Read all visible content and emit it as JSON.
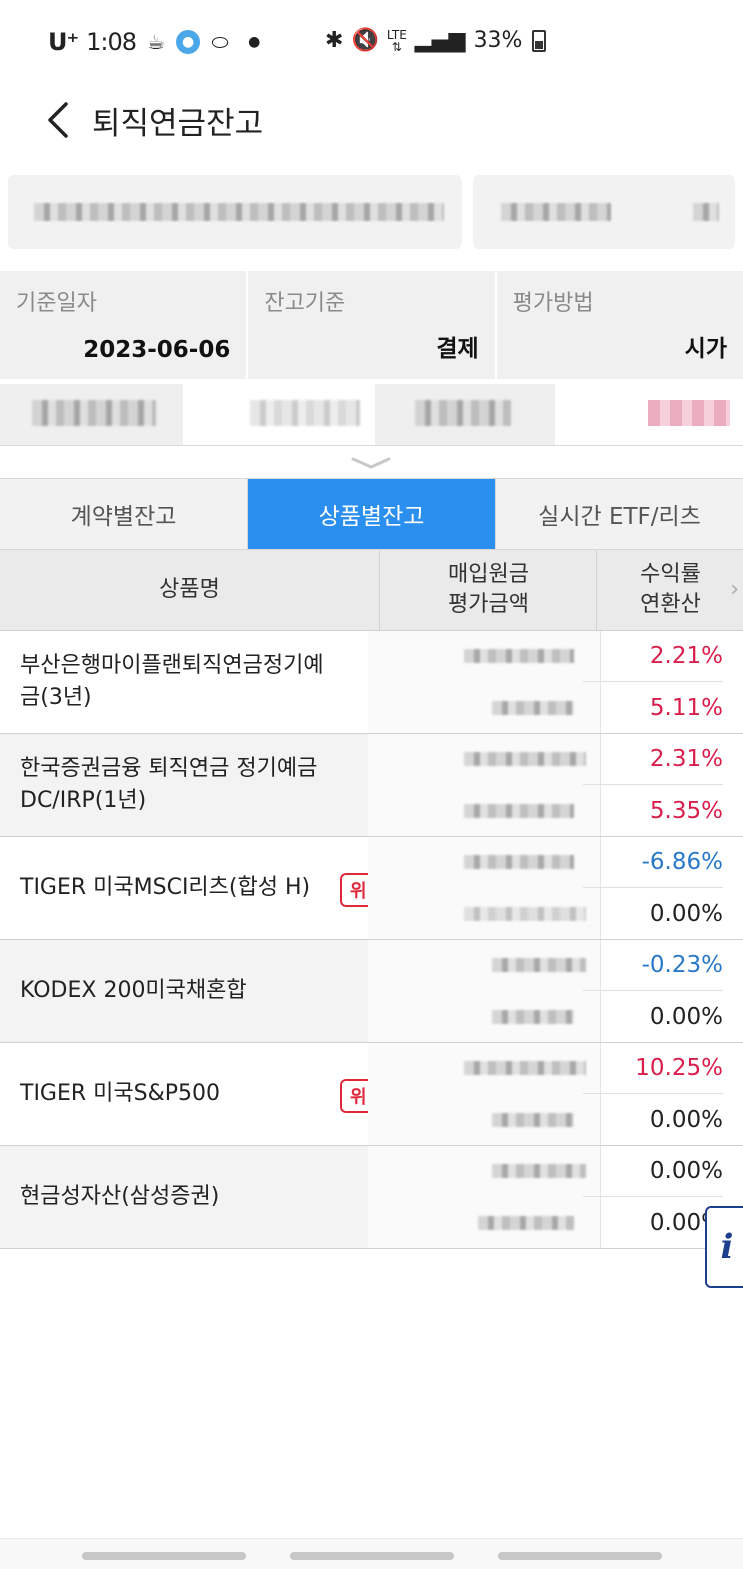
{
  "status_bar": {
    "carrier": "U⁺",
    "time": "1:08",
    "battery": "33%",
    "network": "LTE",
    "icons": [
      "coffee-icon",
      "location-icon",
      "pill-icon",
      "dot-icon",
      "bluetooth-icon",
      "mute-icon",
      "lte-icon",
      "signal-icon",
      "battery-icon"
    ]
  },
  "header": {
    "title": "퇴직연금잔고",
    "back_icon": "chevron-left-icon"
  },
  "info": {
    "cells": [
      {
        "label": "기준일자",
        "value": "2023-06-06"
      },
      {
        "label": "잔고기준",
        "value": "결제"
      },
      {
        "label": "평가방법",
        "value": "시가"
      }
    ]
  },
  "tabs": [
    {
      "label": "계약별잔고",
      "active": false
    },
    {
      "label": "상품별잔고",
      "active": true
    },
    {
      "label": "실시간 ETF/리츠",
      "active": false
    }
  ],
  "table": {
    "headers": {
      "product": "상품명",
      "principal_line1": "매입원금",
      "principal_line2": "평가금액",
      "rate_line1": "수익률",
      "rate_line2": "연환산"
    },
    "rows": [
      {
        "name": "부산은행마이플랜퇴직연금정기예금(3년)",
        "badge": "",
        "rate": "2.21%",
        "annualized": "5.11%",
        "rate_sign": "pos",
        "ann_sign": "pos",
        "shaded": false
      },
      {
        "name": "한국증권금융 퇴직연금 정기예금 DC/IRP(1년)",
        "badge": "",
        "rate": "2.31%",
        "annualized": "5.35%",
        "rate_sign": "pos",
        "ann_sign": "pos",
        "shaded": true
      },
      {
        "name": "TIGER 미국MSCI리츠(합성 H)",
        "badge": "위",
        "rate": "-6.86%",
        "annualized": "0.00%",
        "rate_sign": "neg",
        "ann_sign": "zero",
        "shaded": false
      },
      {
        "name": "KODEX 200미국채혼합",
        "badge": "",
        "rate": "-0.23%",
        "annualized": "0.00%",
        "rate_sign": "neg",
        "ann_sign": "zero",
        "shaded": true
      },
      {
        "name": "TIGER 미국S&P500",
        "badge": "위",
        "rate": "10.25%",
        "annualized": "0.00%",
        "rate_sign": "pos",
        "ann_sign": "zero",
        "shaded": false
      },
      {
        "name": "현금성자산(삼성증권)",
        "badge": "",
        "rate": "0.00%",
        "annualized": "0.00%",
        "rate_sign": "zero",
        "ann_sign": "zero",
        "shaded": true
      }
    ]
  },
  "fab": {
    "label": "i"
  },
  "colors": {
    "accent": "#2b8ff0",
    "positive": "#d81e4a",
    "negative": "#2a78c8",
    "badge": "#e0283c"
  }
}
